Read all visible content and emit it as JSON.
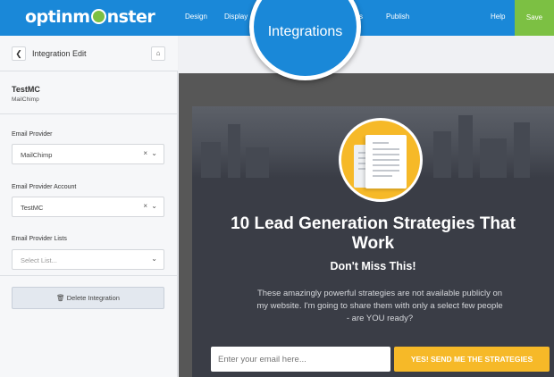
{
  "brand": {
    "logo_text_left": "optinm",
    "logo_text_right": "nster"
  },
  "nav": {
    "design": "Design",
    "display": "Display",
    "integrations": "Integrations",
    "analytics": "tics",
    "publish": "Publish",
    "help": "Help",
    "save": "Save"
  },
  "sidebar": {
    "title": "Integration Edit",
    "account_name": "TestMC",
    "account_provider": "MailChimp",
    "email_provider": {
      "label": "Email Provider",
      "value": "MailChimp"
    },
    "provider_account": {
      "label": "Email Provider Account",
      "value": "TestMC"
    },
    "provider_lists": {
      "label": "Email Provider Lists",
      "placeholder": "Select List..."
    },
    "delete_button": "Delete Integration"
  },
  "optin": {
    "headline": "10 Lead Generation Strategies That Work",
    "subheadline": "Don't Miss This!",
    "description": "These amazingly powerful strategies are not available publicly on my website. I'm going to share them with only a select few people - are YOU ready?",
    "email_placeholder": "Enter your email here...",
    "cta": "YES! SEND ME THE STRATEGIES"
  },
  "colors": {
    "topbar": "#1a88d8",
    "save_green": "#7cc043",
    "accent_yellow": "#f6b928",
    "optin_bg": "#3a3d46"
  },
  "icons": [
    "chevron-left-icon",
    "home-icon",
    "clear-x-icon",
    "chevron-down-icon",
    "trash-icon",
    "document-icon",
    "monster-logo-icon"
  ]
}
